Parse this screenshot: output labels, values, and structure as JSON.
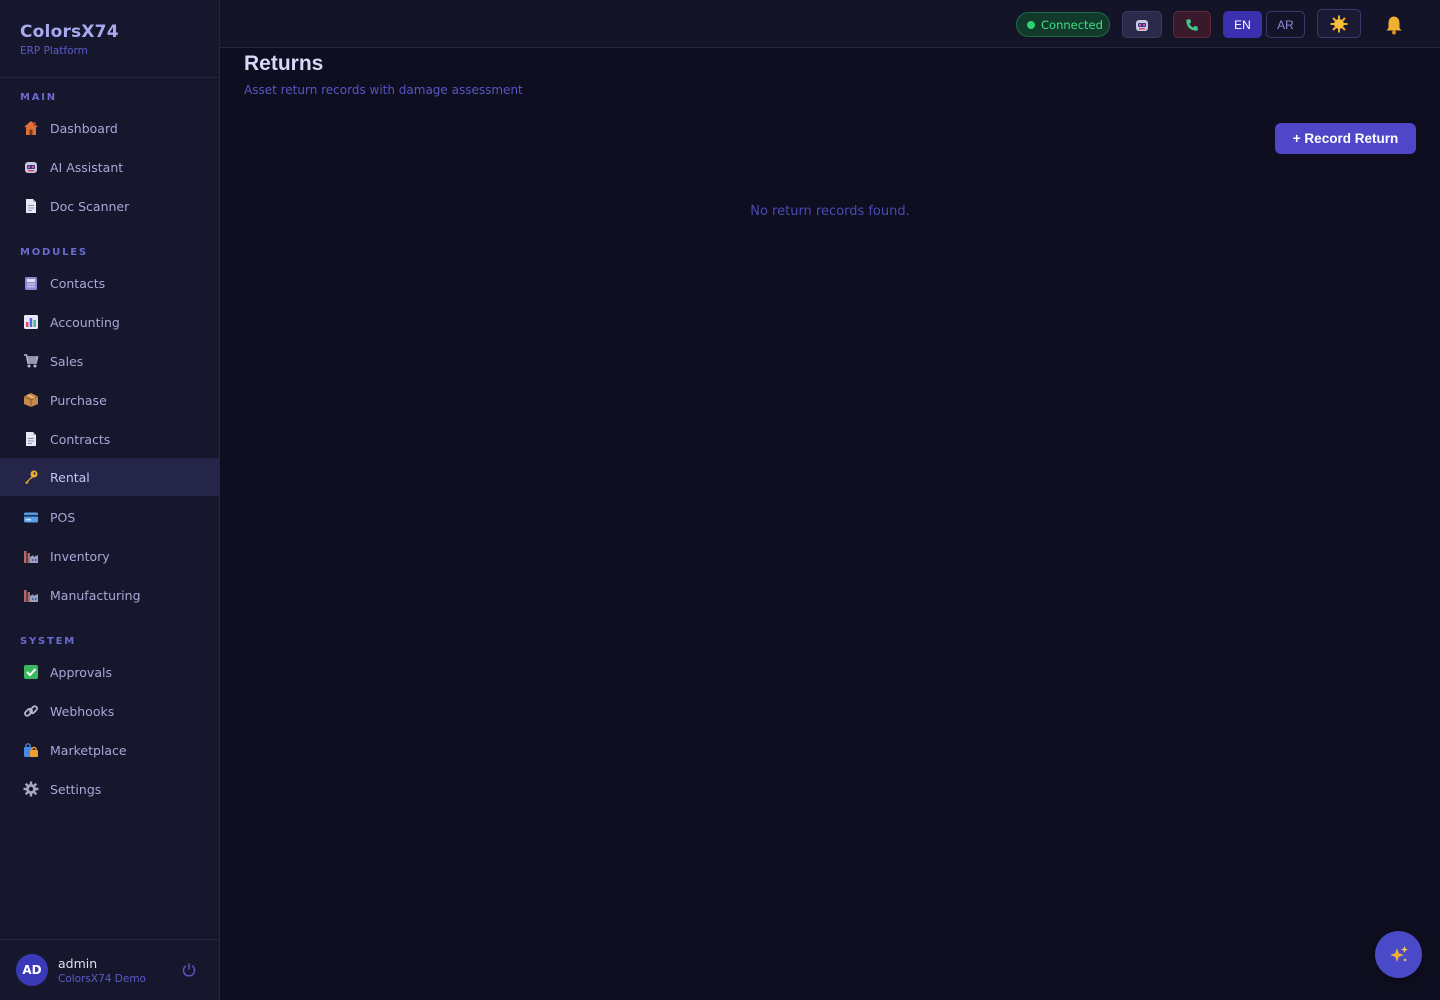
{
  "brand": {
    "title": "ColorsX74",
    "subtitle": "ERP Platform"
  },
  "sidebar": {
    "sections": [
      {
        "label": "MAIN"
      },
      {
        "label": "MODULES"
      },
      {
        "label": "SYSTEM"
      }
    ],
    "items": [
      {
        "label": "Dashboard",
        "icon": "house-icon"
      },
      {
        "label": "AI Assistant",
        "icon": "robot-icon"
      },
      {
        "label": "Doc Scanner",
        "icon": "document-icon"
      },
      {
        "label": "Contacts",
        "icon": "contacts-icon"
      },
      {
        "label": "Accounting",
        "icon": "bar-chart-icon"
      },
      {
        "label": "Sales",
        "icon": "cart-icon"
      },
      {
        "label": "Purchase",
        "icon": "package-icon"
      },
      {
        "label": "Contracts",
        "icon": "document-icon"
      },
      {
        "label": "Rental",
        "icon": "key-icon",
        "active": true
      },
      {
        "label": "POS",
        "icon": "credit-card-icon"
      },
      {
        "label": "Inventory",
        "icon": "factory-icon"
      },
      {
        "label": "Manufacturing",
        "icon": "factory-icon"
      },
      {
        "label": "Approvals",
        "icon": "check-box-icon"
      },
      {
        "label": "Webhooks",
        "icon": "link-icon"
      },
      {
        "label": "Marketplace",
        "icon": "shopping-bags-icon"
      },
      {
        "label": "Settings",
        "icon": "gear-icon"
      }
    ]
  },
  "user": {
    "initials": "AD",
    "name": "admin",
    "org": "ColorsX74 Demo"
  },
  "topbar": {
    "status": "Connected",
    "lang_en": "EN",
    "lang_ar": "AR",
    "active_lang": "EN"
  },
  "page": {
    "title": "Returns",
    "subtitle": "Asset return records with damage assessment",
    "action_label": "+ Record Return",
    "empty_message": "No return records found."
  },
  "colors": {
    "background": "#0e0e20",
    "sidebar": "#16162c",
    "accent": "#4f46c8",
    "connected": "#3ee088"
  }
}
